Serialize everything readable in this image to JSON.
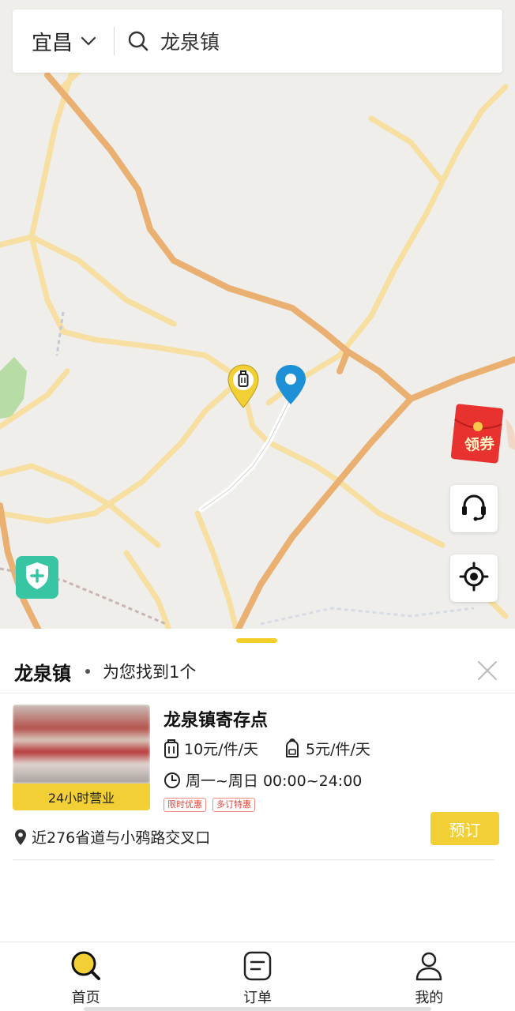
{
  "search": {
    "city": "宜昌",
    "query": "龙泉镇",
    "city_chevron_icon": "chevron-down-icon",
    "search_icon": "search-icon"
  },
  "map": {
    "markers": [
      "luggage-pin-icon",
      "location-pin-icon"
    ],
    "coupon_label": "领券",
    "controls": [
      "headset-icon",
      "locate-icon",
      "shield-plus-icon"
    ]
  },
  "panel": {
    "title": "龙泉镇",
    "result_text": "为您找到1个",
    "close_icon": "close-icon"
  },
  "store": {
    "name": "龙泉镇寄存点",
    "badge": "24小时营业",
    "price_luggage": "10元/件/天",
    "price_bag": "5元/件/天",
    "hours": "周一~周日 00:00~24:00",
    "tags": [
      "限时优惠",
      "多订特惠"
    ],
    "address": "近276省道与小鸦路交叉口",
    "book_label": "预订"
  },
  "tabbar": {
    "items": [
      {
        "label": "首页",
        "icon": "search-icon"
      },
      {
        "label": "订单",
        "icon": "order-icon"
      },
      {
        "label": "我的",
        "icon": "user-icon"
      }
    ]
  },
  "colors": {
    "accent_yellow": "#f2cf35",
    "pin_blue": "#1e90d6",
    "road_orange": "#eab071",
    "road_yellow": "#f6dfa0",
    "tag_red": "#e2453c",
    "shield_green": "#37c5a3"
  }
}
